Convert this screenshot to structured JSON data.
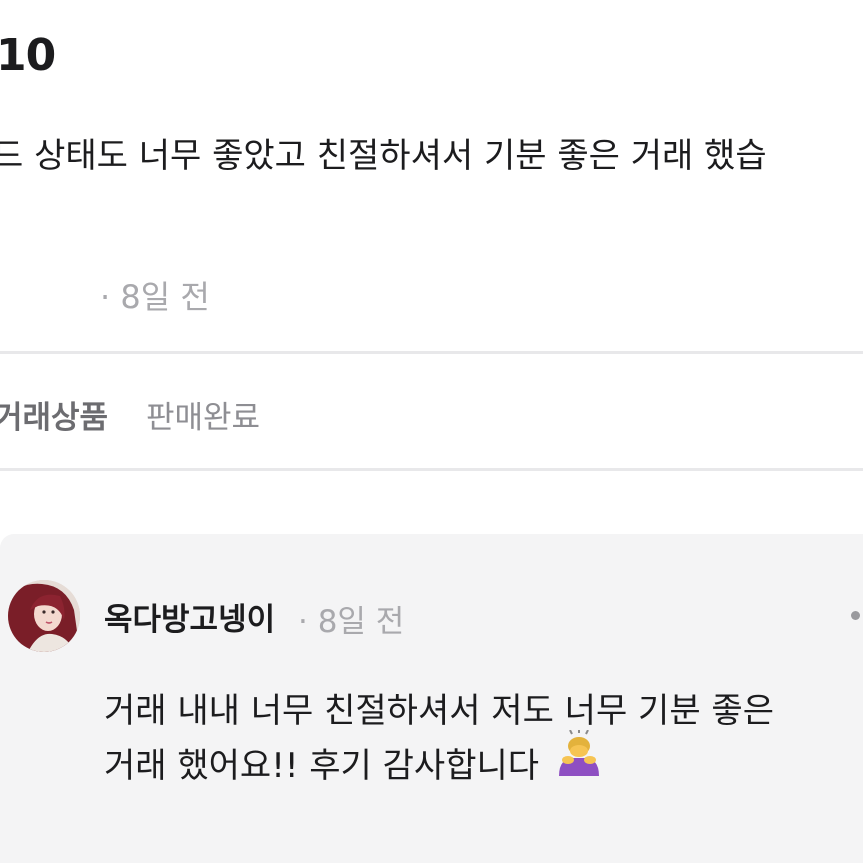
{
  "review": {
    "score": "10",
    "text": "드 상태도 너무 좋았고 친절하셔서 기분 좋은 거래 했습",
    "meta": "· 8일 전"
  },
  "trade": {
    "label": "거래상품",
    "status": "판매완료"
  },
  "reply": {
    "author": "옥다방고넹이",
    "meta": "· 8일 전",
    "line1": "거래 내내 너무 친절하셔서 저도 너무 기분 좋은",
    "line2": "거래 했어요!! 후기 감사합니다",
    "emoji_icon": "person-bowing-icon"
  },
  "colors": {
    "divider": "#e8e8ea",
    "reply_bg": "#f4f4f5",
    "muted_text": "#a9a9ad"
  }
}
